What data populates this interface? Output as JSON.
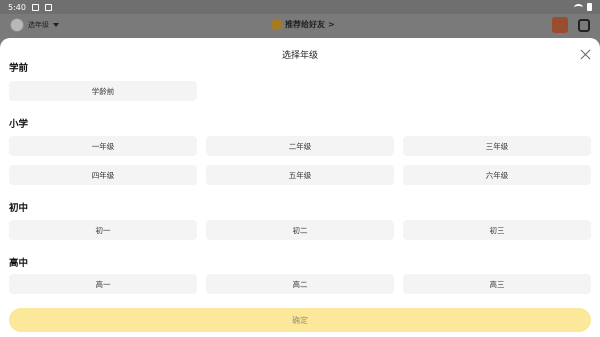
{
  "status": {
    "time": "5:40"
  },
  "header": {
    "grade_label": "选年级",
    "recommend_label": "推荐给好友"
  },
  "sheet": {
    "title": "选择年级",
    "sections": [
      {
        "title": "学前",
        "options": [
          "学龄前"
        ]
      },
      {
        "title": "小学",
        "options": [
          "一年级",
          "二年级",
          "三年级",
          "四年级",
          "五年级",
          "六年级"
        ]
      },
      {
        "title": "初中",
        "options": [
          "初一",
          "初二",
          "初三"
        ]
      },
      {
        "title": "高中",
        "options": [
          "高一",
          "高二",
          "高三"
        ]
      }
    ],
    "confirm_label": "确定"
  }
}
